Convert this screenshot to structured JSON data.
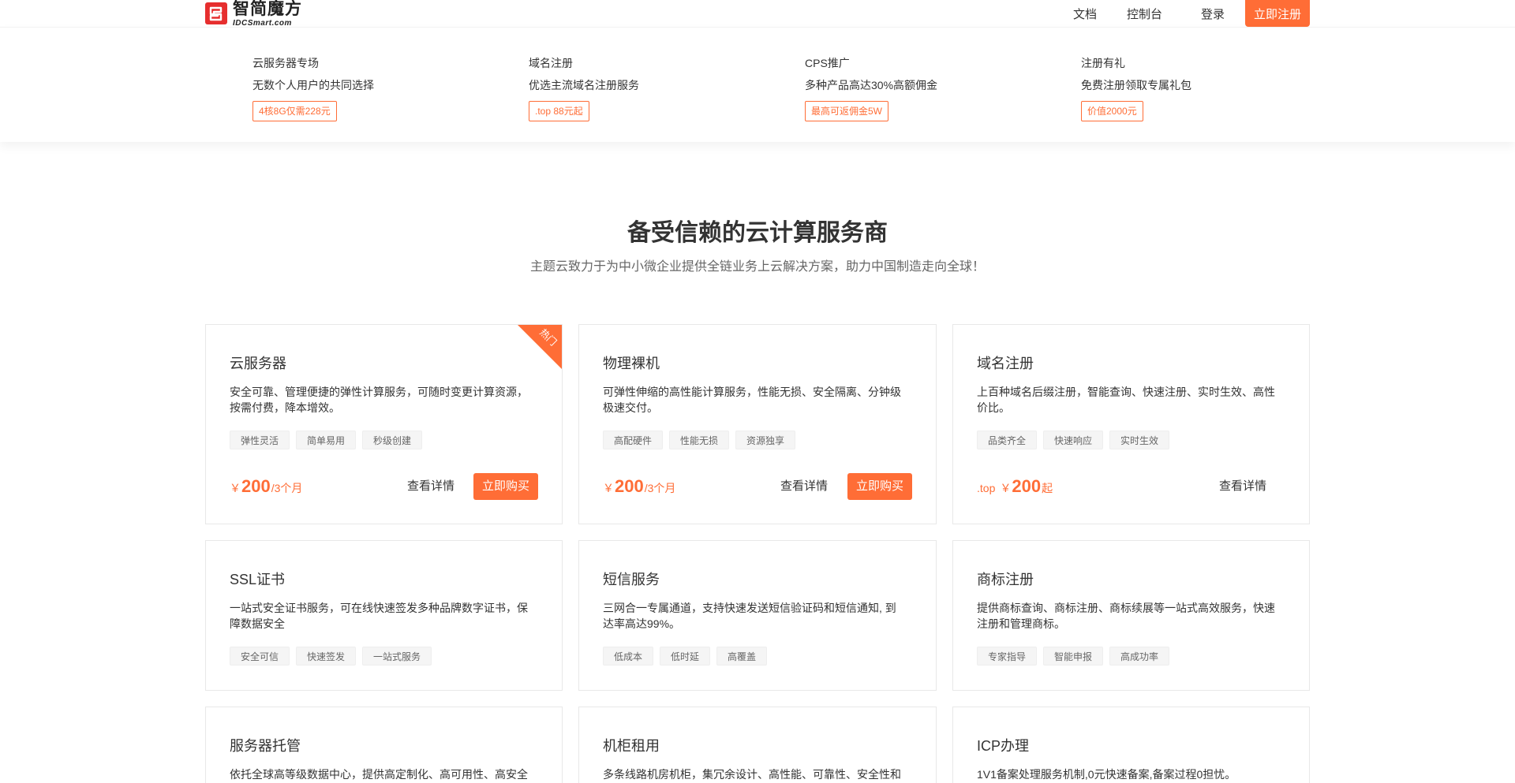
{
  "header": {
    "logo_cn": "智简魔方",
    "logo_en": "IDCSmart.com",
    "nav": [
      "文档",
      "控制台",
      "登录"
    ],
    "register": "立即注册"
  },
  "promo": [
    {
      "title": "云服务器专场",
      "desc": "无数个人用户的共同选择",
      "tag": "4核8G仅需228元"
    },
    {
      "title": "域名注册",
      "desc": "优选主流域名注册服务",
      "tag": ".top 88元起"
    },
    {
      "title": "CPS推广",
      "desc": "多种产品高达30%高额佣金",
      "tag": "最高可返佣金5W"
    },
    {
      "title": "注册有礼",
      "desc": "免费注册领取专属礼包",
      "tag": "价值2000元"
    }
  ],
  "section": {
    "title": "备受信赖的云计算服务商",
    "subtitle": "主题云致力于为中小微企业提供全链业务上云解决方案，助力中国制造走向全球！"
  },
  "cards": [
    {
      "title": "云服务器",
      "desc": "安全可靠、管理便捷的弹性计算服务，可随时变更计算资源，按需付费，降本增效。",
      "tags": [
        "弹性灵活",
        "简单易用",
        "秒级创建"
      ],
      "price_symbol": "￥",
      "price": "200",
      "price_unit": "/3个月",
      "detail": "查看详情",
      "buy": "立即购买",
      "badge": "热门"
    },
    {
      "title": "物理裸机",
      "desc": "可弹性伸缩的高性能计算服务，性能无损、安全隔离、分钟级极速交付。",
      "tags": [
        "高配硬件",
        "性能无损",
        "资源独享"
      ],
      "price_symbol": "￥",
      "price": "200",
      "price_unit": "/3个月",
      "detail": "查看详情",
      "buy": "立即购买"
    },
    {
      "title": "域名注册",
      "desc": "上百种域名后缀注册，智能查询、快速注册、实时生效、高性价比。",
      "tags": [
        "品类齐全",
        "快速响应",
        "实时生效"
      ],
      "price_prefix": ".top",
      "price_symbol": "￥",
      "price": "200",
      "price_unit": "起",
      "detail": "查看详情"
    },
    {
      "title": "SSL证书",
      "desc": "一站式安全证书服务，可在线快速签发多种品牌数字证书，保障数据安全",
      "tags": [
        "安全可信",
        "快速签发",
        "一站式服务"
      ]
    },
    {
      "title": "短信服务",
      "desc": "三网合一专属通道，支持快速发送短信验证码和短信通知, 到达率高达99%。",
      "tags": [
        "低成本",
        "低时延",
        "高覆盖"
      ]
    },
    {
      "title": "商标注册",
      "desc": "提供商标查询、商标注册、商标续展等一站式高效服务，快速注册和管理商标。",
      "tags": [
        "专家指导",
        "智能申报",
        "高成功率"
      ]
    },
    {
      "title": "服务器托管",
      "desc": "依托全球高等级数据中心，提供高定制化、高可用性、高安全"
    },
    {
      "title": "机柜租用",
      "desc": "多条线路机房机柜，集冗余设计、高性能、可靠性、安全性和"
    },
    {
      "title": "ICP办理",
      "desc": "1V1备案处理服务机制,0元快速备案,备案过程0担忧。"
    }
  ]
}
